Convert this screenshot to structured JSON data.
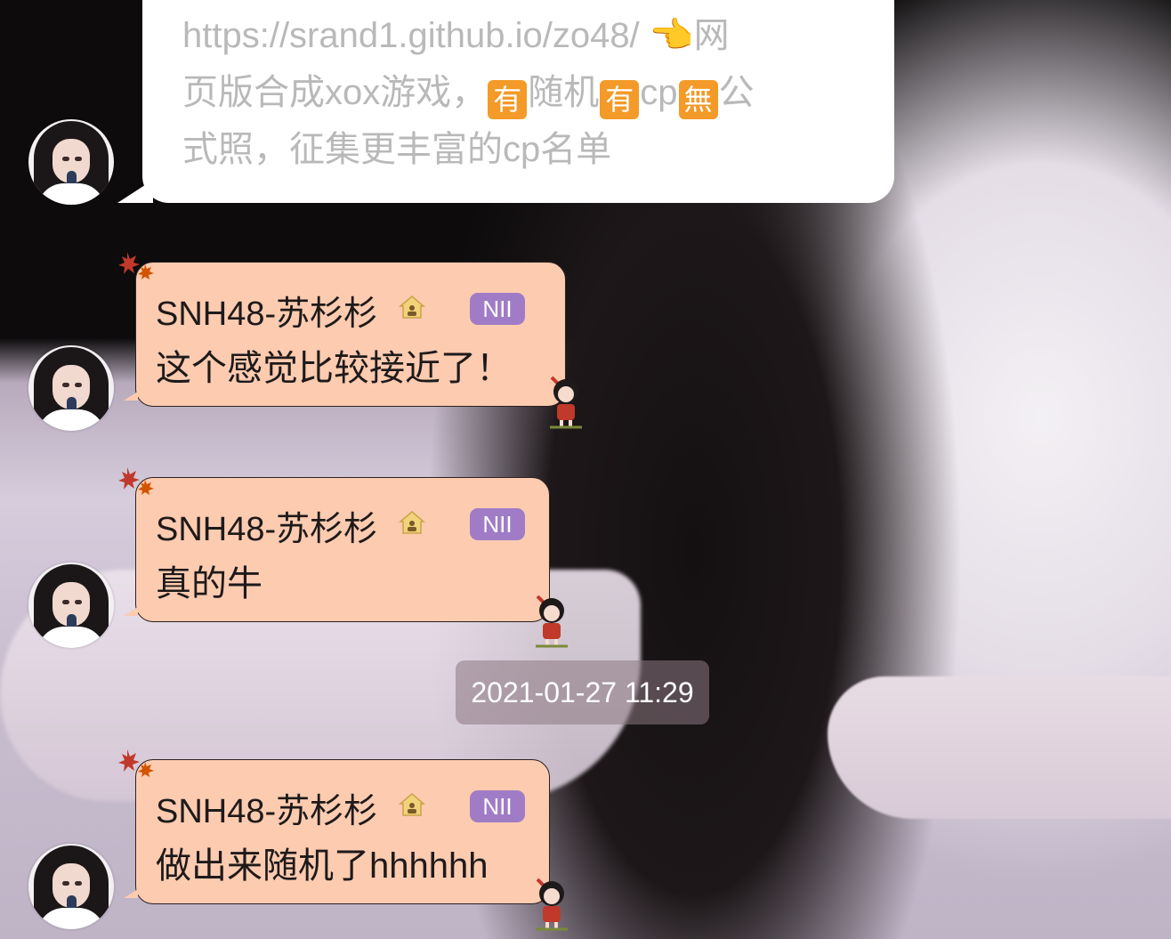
{
  "top_message": {
    "link": "https://srand1.github.io/zo48/",
    "pointing_emoji": "👈",
    "line1_tail": "网",
    "line2_part1": "页版合成xox游戏，",
    "box1": "有",
    "line2_part2": "随机",
    "box2": "有",
    "line2_part3": "cp",
    "box3": "無",
    "line2_part4": "公",
    "line3": "式照，征集更丰富的cp名单"
  },
  "messages": [
    {
      "sender": "SNH48-苏杉杉",
      "badge": "NII",
      "text": "这个感觉比较接近了！"
    },
    {
      "sender": "SNH48-苏杉杉",
      "badge": "NII",
      "text": "真的牛"
    },
    {
      "sender": "SNH48-苏杉杉",
      "badge": "NII",
      "text": "做出来随机了hhhhhh"
    }
  ],
  "timestamp": "2021-01-27 11:29",
  "colors": {
    "bubble_bg": "#fccbb0",
    "badge_bg": "#a07cc6",
    "box_emoji_bg": "#f39a28",
    "white_text": "#b9b9b9"
  },
  "icons": [
    "home-icon",
    "maple-leaf-icon",
    "chibi-sticker-icon",
    "avatar"
  ]
}
